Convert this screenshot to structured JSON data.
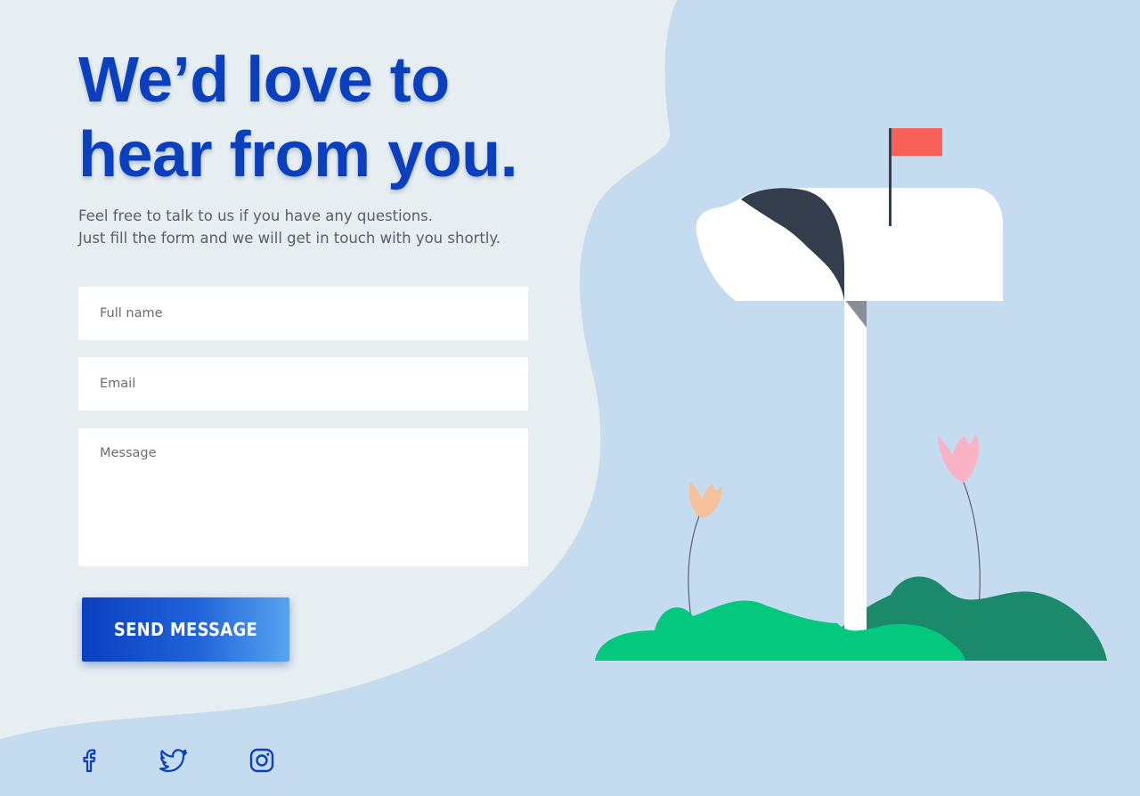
{
  "hero": {
    "headline_line1": "We’d love to",
    "headline_line2": "hear from you.",
    "subtitle_line1": "Feel free to talk to us if you have any questions.",
    "subtitle_line2": "Just fill the form and we will get in touch with you shortly."
  },
  "form": {
    "full_name_placeholder": "Full name",
    "email_placeholder": "Email",
    "message_placeholder": "Message",
    "submit_label": "SEND MESSAGE"
  },
  "social": {
    "items": [
      {
        "name": "facebook-icon"
      },
      {
        "name": "twitter-icon"
      },
      {
        "name": "instagram-icon"
      }
    ]
  },
  "colors": {
    "background_light": "#e6eef2",
    "background_blue": "#c5dbf0",
    "headline": "#0a3fc0",
    "button_start": "#0a3fc0",
    "button_end": "#57a4ef",
    "flag": "#f8605a",
    "bush_light": "#03c87e",
    "bush_dark": "#1a8a6b",
    "mailbox_door": "#343d4b"
  }
}
